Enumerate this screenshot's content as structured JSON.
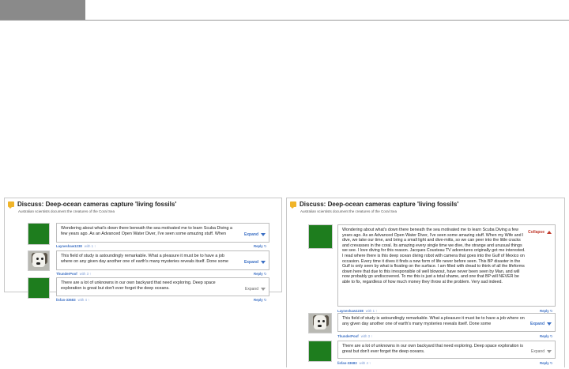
{
  "discussion": {
    "title": "Discuss: Deep-ocean cameras capture 'living fossils'",
    "subtitle": "Australian scientists document the creatures of the Coral Sea"
  },
  "actions": {
    "expand": "Expand",
    "collapse": "Collapse",
    "reply": "Reply",
    "reply_icon": "↻"
  },
  "left_panel": {
    "comments": [
      {
        "text": "Wondering about what's down there beneath the sea motivated me to learn Scuba Diving a few years ago. As an Advanced Open Water Diver, I've seen some amazing stuff. When",
        "user": "Layneshaw1238",
        "likes": "with 1 ↑"
      },
      {
        "text": "This field of study is astoundingly remarkable. What a pleasure it must be to have a job where on any given day another one of earth's many mysteries reveals itself. Done some",
        "user": "ThunderPoof",
        "likes": "with 3 ↑"
      },
      {
        "text": "There are a lot of unknowns in our own backyard that need exploring. Deep space exploration is great but don't ever forget the deep oceans.",
        "user": "lisfan-33683",
        "likes": "with 4 ↑"
      }
    ]
  },
  "right_panel": {
    "comments": [
      {
        "p1": "Wondering about what's down there beneath the sea motivated me to learn Scuba Diving a few years ago. As an Advanced Open Water Diver, I've seen some amazing stuff. When my Wife and I dive, we take our time, and bring a small light and dive-mitts, so we can peer into the little cracks and crevasses in the coral. Its amazing every single time we dive, the strange and unusual things we see. I love diving for this reason. Jacques Cousteau TV adventures originally got me interested.",
        "p2": "I read where there is this deep ocean diving robot with camera that goes into the Gulf of Mexico on occasion. Every time it dives it finds a new form of life never before seen. This BP disaster in the Gulf is only seen by what is floating on the surface. I am filled with dread to think of all the lifeforms down here that due to this irresponsible oil well blowout, have never been seen by Man, and will now probably go undiscovered. To me this is just a total shame, and one that BP will NEVER be able to fix, regardless of how much money they throw at the problem. Very sad indeed.",
        "user": "Layneshaw1238",
        "likes": "with 1 ↑"
      },
      {
        "text": "This field of study is astoundingly remarkable. What a pleasure it must be to have a job where on any given day another one of earth's many mysteries reveals itself. Done some",
        "user": "ThunderPoof",
        "likes": "with 3 ↑"
      },
      {
        "text": "There are a lot of unknowns in our own backyard that need exploring. Deep space exploration is great but don't ever forget the deep oceans.",
        "user": "lisfan-33683",
        "likes": "with 4 ↑"
      }
    ]
  },
  "colors": {
    "link": "#3b6fc4",
    "collapse": "#c0392b",
    "avatar_green": "#1e7d1e",
    "title_icon": "#f0b429",
    "header_block": "#8a8a8a"
  },
  "icons": [
    "comment-bubble-icon",
    "chevron-down-icon",
    "chevron-up-icon",
    "reply-icon"
  ]
}
